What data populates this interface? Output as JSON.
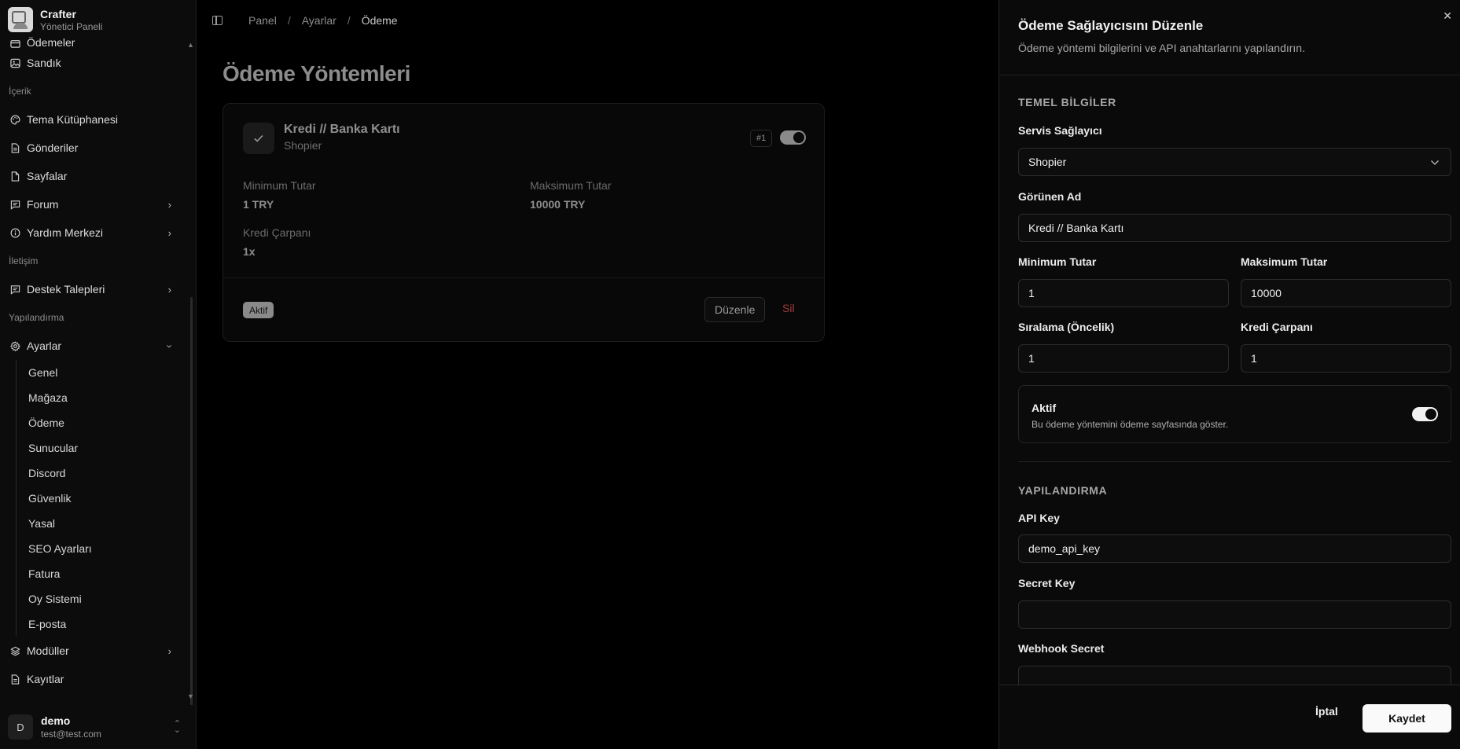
{
  "brand": {
    "name": "Crafter",
    "subtitle": "Yönetici Paneli"
  },
  "sidebar": {
    "items_top": [
      {
        "label": "Ödemeler"
      },
      {
        "label": "Sandık"
      }
    ],
    "section_content": "İçerik",
    "content_items": [
      {
        "label": "Tema Kütüphanesi"
      },
      {
        "label": "Gönderiler"
      },
      {
        "label": "Sayfalar"
      },
      {
        "label": "Forum"
      },
      {
        "label": "Yardım Merkezi"
      }
    ],
    "section_comm": "İletişim",
    "comm_items": [
      {
        "label": "Destek Talepleri"
      }
    ],
    "section_config": "Yapılandırma",
    "settings_label": "Ayarlar",
    "settings_sub": [
      {
        "label": "Genel"
      },
      {
        "label": "Mağaza"
      },
      {
        "label": "Ödeme"
      },
      {
        "label": "Sunucular"
      },
      {
        "label": "Discord"
      },
      {
        "label": "Güvenlik"
      },
      {
        "label": "Yasal"
      },
      {
        "label": "SEO Ayarları"
      },
      {
        "label": "Fatura"
      },
      {
        "label": "Oy Sistemi"
      },
      {
        "label": "E-posta"
      }
    ],
    "modules_label": "Modüller",
    "logs_label": "Kayıtlar"
  },
  "user": {
    "initial": "D",
    "name": "demo",
    "email": "test@test.com"
  },
  "breadcrumb": {
    "items": [
      "Panel",
      "Ayarlar",
      "Ödeme"
    ],
    "separator": "/"
  },
  "page": {
    "title": "Ödeme Yöntemleri"
  },
  "card": {
    "name": "Kredi // Banka Kartı",
    "provider": "Shopier",
    "badge": "#1",
    "enabled": true,
    "min_label": "Minimum Tutar",
    "min_value": "1 TRY",
    "max_label": "Maksimum Tutar",
    "max_value": "10000 TRY",
    "mult_label": "Kredi Çarpanı",
    "mult_value": "1x",
    "status": "Aktif",
    "edit_label": "Düzenle",
    "delete_label": "Sil"
  },
  "drawer": {
    "title": "Ödeme Sağlayıcısını Düzenle",
    "description": "Ödeme yöntemi bilgilerini ve API anahtarlarını yapılandırın.",
    "section_basic": "TEMEL BİLGİLER",
    "provider_label": "Servis Sağlayıcı",
    "provider_value": "Shopier",
    "display_name_label": "Görünen Ad",
    "display_name_value": "Kredi // Banka Kartı",
    "min_label": "Minimum Tutar",
    "min_value": "1",
    "max_label": "Maksimum Tutar",
    "max_value": "10000",
    "order_label": "Sıralama (Öncelik)",
    "order_value": "1",
    "multiplier_label": "Kredi Çarpanı",
    "multiplier_value": "1",
    "active_title": "Aktif",
    "active_desc": "Bu ödeme yöntemini ödeme sayfasında göster.",
    "active_on": true,
    "section_config": "YAPILANDIRMA",
    "api_key_label": "API Key",
    "api_key_value": "demo_api_key",
    "secret_key_label": "Secret Key",
    "secret_key_value": "",
    "webhook_label": "Webhook Secret",
    "webhook_value": "",
    "cancel_label": "İptal",
    "save_label": "Kaydet"
  },
  "colors": {
    "accent": "#fafafa",
    "danger": "#a33a3a",
    "background": "#000000"
  }
}
